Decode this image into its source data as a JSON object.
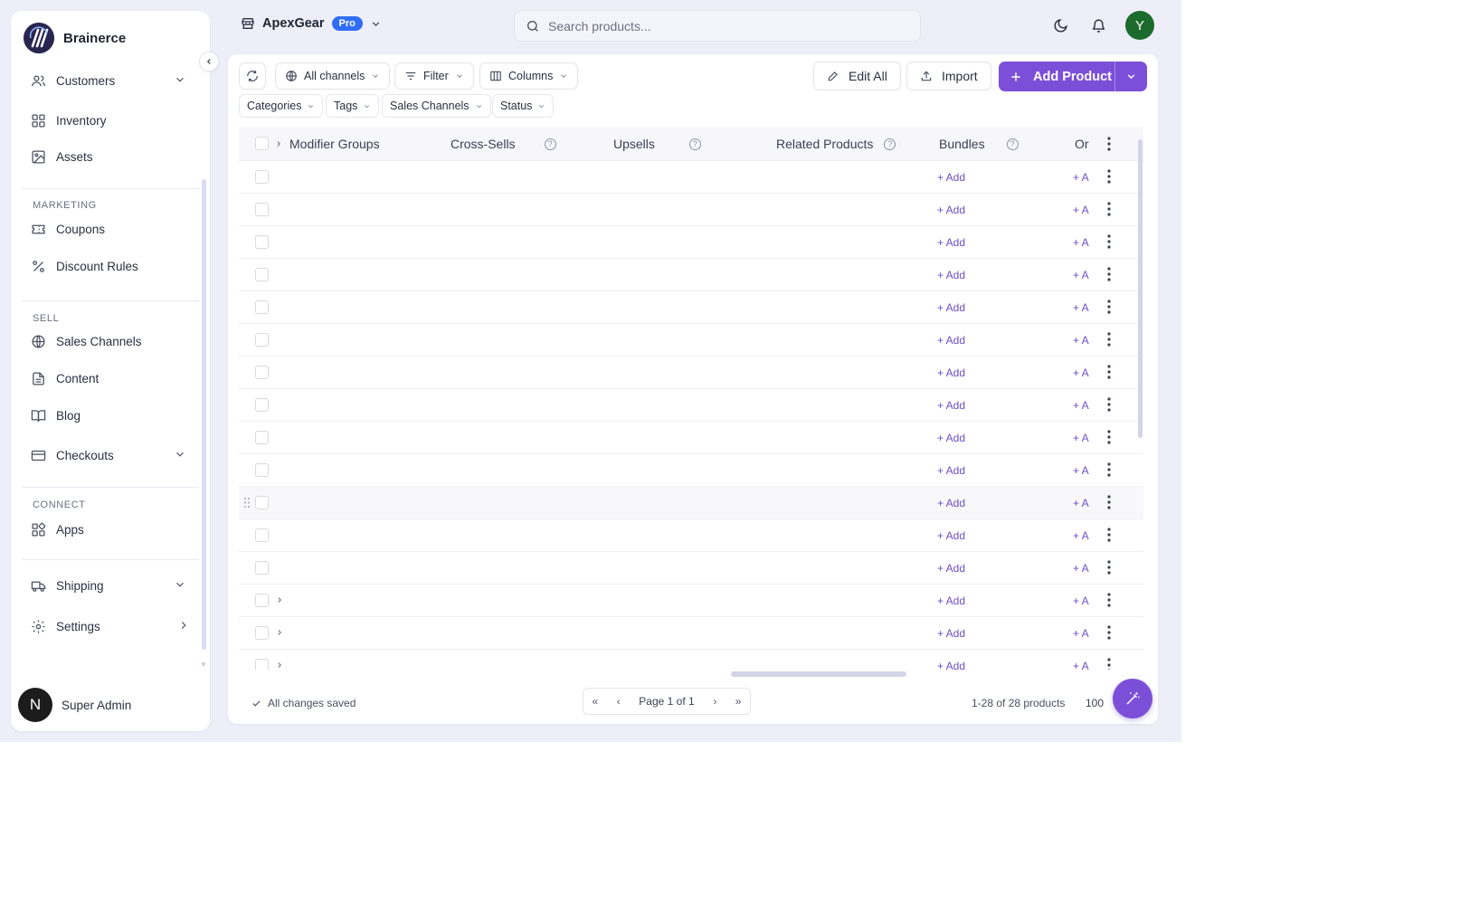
{
  "brand": {
    "name": "Brainerce"
  },
  "sidebar": {
    "items": [
      {
        "label": "Customers"
      },
      {
        "label": "Inventory"
      },
      {
        "label": "Assets"
      },
      {
        "label": "Coupons"
      },
      {
        "label": "Discount Rules"
      },
      {
        "label": "Sales Channels"
      },
      {
        "label": "Content"
      },
      {
        "label": "Blog"
      },
      {
        "label": "Checkouts"
      },
      {
        "label": "Apps"
      },
      {
        "label": "Shipping"
      },
      {
        "label": "Settings"
      }
    ],
    "sections": {
      "marketing": "MARKETING",
      "sell": "SELL",
      "connect": "CONNECT"
    },
    "user": {
      "initial": "N",
      "name": "Super Admin"
    }
  },
  "topbar": {
    "store_name": "ApexGear",
    "plan_badge": "Pro",
    "search_placeholder": "Search products...",
    "avatar_initial": "Y"
  },
  "toolbar": {
    "channels_label": "All channels",
    "filter_label": "Filter",
    "columns_label": "Columns",
    "edit_all_label": "Edit All",
    "import_label": "Import",
    "add_product_label": "Add Product"
  },
  "filters": [
    "Categories",
    "Tags",
    "Sales Channels",
    "Status"
  ],
  "table": {
    "columns": [
      {
        "label": "Modifier Groups"
      },
      {
        "label": "Cross-Sells"
      },
      {
        "label": "Upsells"
      },
      {
        "label": "Related Products"
      },
      {
        "label": "Bundles"
      },
      {
        "label": "Or"
      }
    ],
    "rows": [
      {
        "bundles": "+ Add",
        "next": "+ A"
      },
      {
        "bundles": "+ Add",
        "next": "+ A"
      },
      {
        "bundles": "+ Add",
        "next": "+ A"
      },
      {
        "bundles": "+ Add",
        "next": "+ A"
      },
      {
        "bundles": "+ Add",
        "next": "+ A"
      },
      {
        "bundles": "+ Add",
        "next": "+ A"
      },
      {
        "bundles": "+ Add",
        "next": "+ A"
      },
      {
        "bundles": "+ Add",
        "next": "+ A"
      },
      {
        "bundles": "+ Add",
        "next": "+ A"
      },
      {
        "bundles": "+ Add",
        "next": "+ A"
      },
      {
        "bundles": "+ Add",
        "next": "+ A"
      },
      {
        "bundles": "+ Add",
        "next": "+ A"
      },
      {
        "bundles": "+ Add",
        "next": "+ A"
      },
      {
        "bundles": "+ Add",
        "next": "+ A"
      },
      {
        "bundles": "+ Add",
        "next": "+ A"
      },
      {
        "bundles": "+ Add",
        "next": "+ A"
      }
    ]
  },
  "footer": {
    "saved_status": "All changes saved",
    "page_label": "Page 1 of 1",
    "count_label": "1-28 of 28 products",
    "per_page": "100"
  },
  "colors": {
    "accent": "#7c4fd8",
    "badge": "#2f6df6",
    "avatar": "#1d6b2c",
    "background": "#eeeef9"
  }
}
